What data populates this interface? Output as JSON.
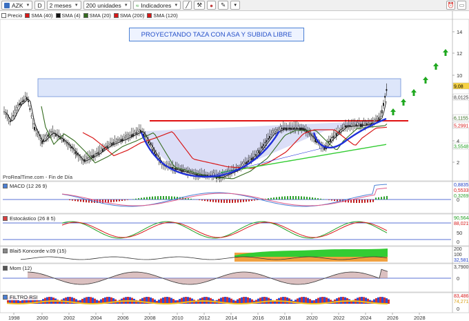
{
  "toolbar": {
    "symbol": "AZK",
    "d_label": "D",
    "period": "2 meses",
    "units": "200 unidades",
    "indicators": "Indicadores"
  },
  "legend": [
    {
      "label": "Precio",
      "color": "#ffffff"
    },
    {
      "label": "SMA (40)",
      "color": "#d81818"
    },
    {
      "label": "SMA (4)",
      "color": "#111111"
    },
    {
      "label": "SMA (20)",
      "color": "#336b1e"
    },
    {
      "label": "SMA (200)",
      "color": "#d81818"
    },
    {
      "label": "SMA (120)",
      "color": "#d81818"
    }
  ],
  "annotation": "PROYECTANDO TAZA CON ASA Y SUBIDA LIBRE",
  "watermark": "ProRealTime.com - Fin de Día",
  "price_axis": {
    "ticks": [
      "14",
      "12",
      "10",
      "8",
      "6",
      "4",
      "2"
    ],
    "tags": [
      {
        "text": "9,08",
        "bg": "#f5d142",
        "fg": "#000"
      },
      {
        "text": "8,0125",
        "bg": "#ffffff",
        "fg": "#333"
      },
      {
        "text": "6,1155",
        "bg": "#ffffff",
        "fg": "#336b1e"
      },
      {
        "text": "5,2991",
        "bg": "#ffffff",
        "fg": "#d81818"
      },
      {
        "text": "3,5548",
        "bg": "#ffffff",
        "fg": "#22a022"
      }
    ]
  },
  "panels": {
    "macd": {
      "label": "MACD (12 26 9)",
      "values": [
        "0,8835",
        "0,5533",
        "0,3269"
      ],
      "ticks": [
        "0"
      ]
    },
    "stoch": {
      "label": "Estocástico (26 8 5)",
      "values": [
        "90,5644",
        "88,0219"
      ],
      "ticks": [
        "50",
        "0"
      ]
    },
    "koncorde": {
      "label": "Blai5 Koncorde v.09 (15)",
      "values": [
        "200",
        "100",
        "32,581"
      ],
      "ticks": [
        "0"
      ]
    },
    "mom": {
      "label": "Mom (12)",
      "values": [
        "3,7900"
      ],
      "ticks": [
        "0"
      ]
    },
    "rsi": {
      "label": "FILTRO RSI",
      "values": [
        "83,486",
        "74,271"
      ],
      "ticks": [
        "0"
      ]
    }
  },
  "x_axis": [
    "1998",
    "2000",
    "2002",
    "2004",
    "2006",
    "2008",
    "2010",
    "2012",
    "2014",
    "2016",
    "2018",
    "2020",
    "2022",
    "2024",
    "2026",
    "2028"
  ]
}
